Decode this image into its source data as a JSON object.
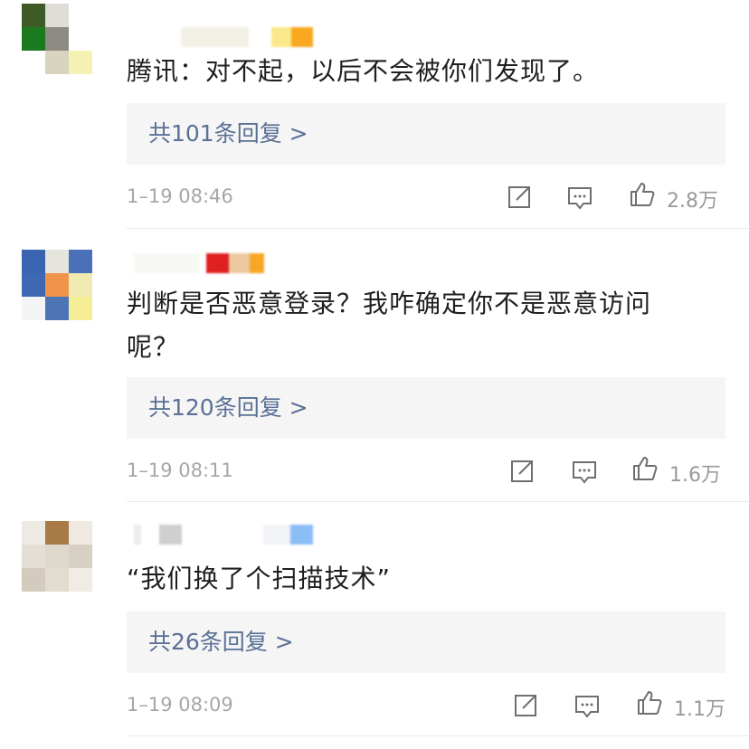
{
  "comments": [
    {
      "text": "腾讯：对不起，以后不会被你们发现了。",
      "replies": "共101条回复 >",
      "time": "1–19 08:46",
      "likes": "2.8万"
    },
    {
      "text": "判断是否恶意登录？我咋确定你不是恶意访问呢？",
      "replies": "共120条回复 >",
      "time": "1–19 08:11",
      "likes": "1.6万"
    },
    {
      "text": "“我们换了个扫描技术”",
      "replies": "共26条回复 >",
      "time": "1–19 08:09",
      "likes": "1.1万"
    }
  ],
  "icons": {
    "share": "share-icon",
    "comment": "comment-icon",
    "like": "like-icon"
  },
  "colors": {
    "reply_link": "#5b7096",
    "reply_bg": "#f5f5f5",
    "meta": "#a7a7a7"
  }
}
